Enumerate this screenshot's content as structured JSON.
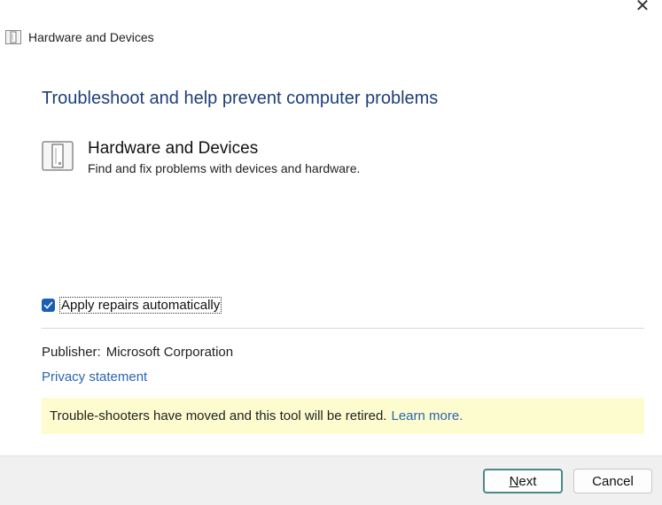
{
  "window": {
    "title": "Hardware and Devices",
    "close_glyph": "✕"
  },
  "heading": "Troubleshoot and help prevent computer problems",
  "tool": {
    "name": "Hardware and Devices",
    "description": "Find and fix problems with devices and hardware.",
    "icon": "hardware-device-icon"
  },
  "repairs": {
    "label": "Apply repairs automatically",
    "checked": true
  },
  "publisher": {
    "label": "Publisher:",
    "value": "Microsoft Corporation"
  },
  "privacy_link": "Privacy statement",
  "notice": {
    "text": "Trouble-shooters have moved and this tool will be retired.",
    "link": "Learn more."
  },
  "buttons": {
    "next_first": "N",
    "next_rest": "ext",
    "cancel": "Cancel"
  },
  "colors": {
    "heading": "#1e3f7a",
    "link": "#2a64b0",
    "notice_bg": "#fcfccf",
    "checkbox": "#1a5fb4",
    "footer_bg": "#f0f0f0"
  }
}
